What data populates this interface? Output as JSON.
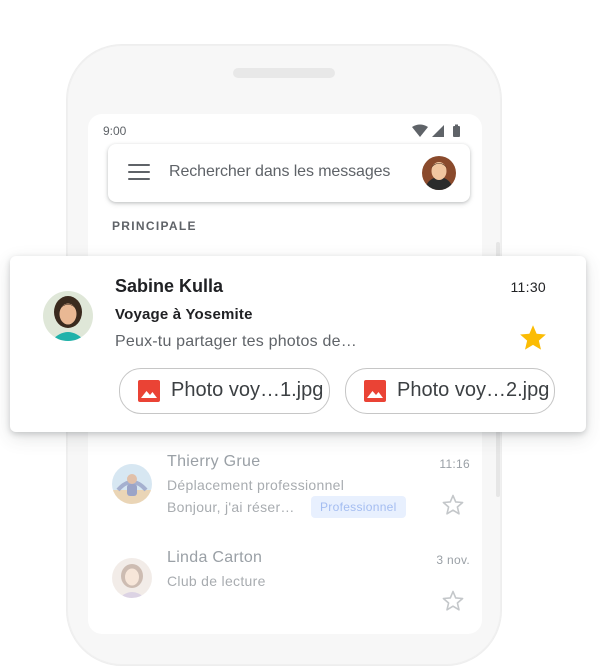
{
  "status_bar": {
    "time": "9:00"
  },
  "search": {
    "placeholder": "Rechercher dans les messages"
  },
  "inbox": {
    "section_label": "PRINCIPALE"
  },
  "highlighted_email": {
    "sender": "Sabine Kulla",
    "time": "11:30",
    "subject": "Voyage à Yosemite",
    "snippet": "Peux-tu partager tes photos de…",
    "starred": true,
    "attachments": [
      {
        "name": "Photo voy…1.jpg",
        "icon": "image-icon"
      },
      {
        "name": "Photo voy…2.jpg",
        "icon": "image-icon"
      }
    ]
  },
  "emails": [
    {
      "sender": "Thierry Grue",
      "time": "11:16",
      "subject": "Déplacement professionnel",
      "snippet": "Bonjour, j'ai réser…",
      "label": "Professionnel",
      "starred": false
    },
    {
      "sender": "Linda Carton",
      "time": "3 nov.",
      "subject": "Club de lecture",
      "snippet": "",
      "label": "",
      "starred": false
    }
  ],
  "colors": {
    "star_active": "#fbbc04",
    "attachment_icon": "#ea4335",
    "label_chip_bg": "#e8f0fe",
    "text_secondary": "#5f6368"
  }
}
